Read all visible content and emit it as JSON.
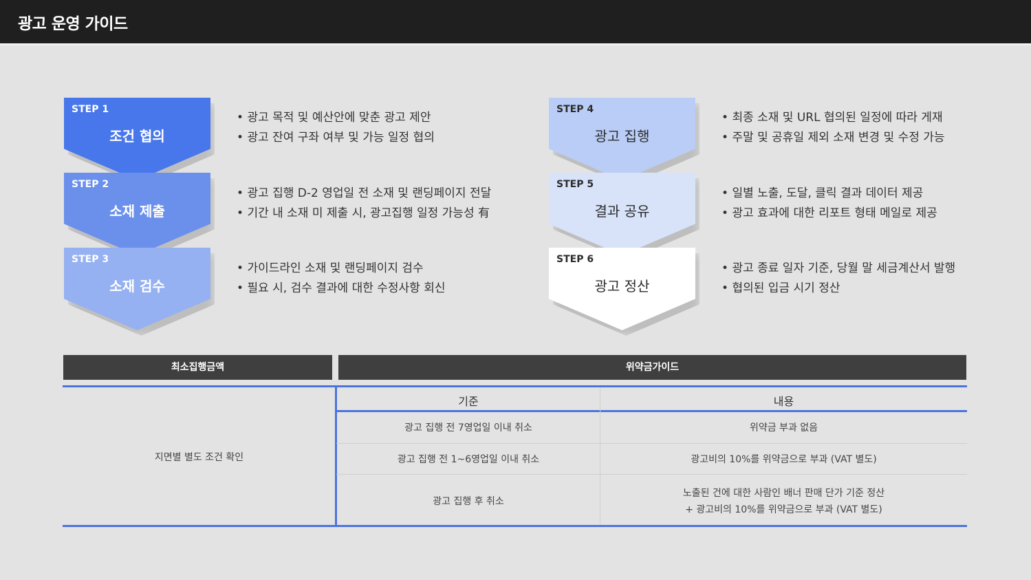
{
  "header": {
    "title": "광고 운영 가이드"
  },
  "steps": [
    {
      "num": "STEP 1",
      "name": "조건 협의",
      "color": "#4777eb",
      "lines": [
        "광고 목적 및 예산안에 맞춘 광고 제안",
        "광고 잔여 구좌 여부 및 가능 일정 협의"
      ]
    },
    {
      "num": "STEP 2",
      "name": "소재 제출",
      "color": "#6b90ec",
      "lines": [
        "광고 집행 D-2 영업일 전 소재 및 랜딩페이지 전달",
        "기간 내 소재 미 제출 시, 광고집행 일정 가능성 有"
      ]
    },
    {
      "num": "STEP 3",
      "name": "소재 검수",
      "color": "#95b1f1",
      "lines": [
        "가이드라인 소재 및 랜딩페이지 검수",
        "필요 시, 검수 결과에 대한 수정사항 회신"
      ]
    },
    {
      "num": "STEP 4",
      "name": "광고 집행",
      "color": "#bacdf6",
      "lines": [
        "최종 소재 및 URL 협의된 일정에 따라 게재",
        "주말 및 공휴일 제외 소재 변경 및 수정 가능"
      ]
    },
    {
      "num": "STEP 5",
      "name": "결과 공유",
      "color": "#d8e3fa",
      "lines": [
        "일별 노출, 도달, 클릭 결과 데이터 제공",
        "광고 효과에 대한 리포트 형태 메일로 제공"
      ]
    },
    {
      "num": "STEP 6",
      "name": "광고 정산",
      "color": "#ffffff",
      "lines": [
        "광고 종료 일자 기준, 당월 말 세금계산서 발행",
        "협의된 입금 시기 정산"
      ]
    }
  ],
  "table": {
    "min_header": "최소집행금액",
    "penalty_header": "위약금가이드",
    "min_value": "지면별 별도 조건 확인",
    "col_criteria": "기준",
    "col_content": "내용",
    "rows": [
      {
        "criteria": "광고 집행 전 7영업일 이내 취소",
        "content": "위약금 부과 없음",
        "content2": ""
      },
      {
        "criteria": "광고 집행 전 1~6영업일 이내 취소",
        "content": "광고비의 10%를 위약금으로 부과 (VAT 별도)",
        "content2": ""
      },
      {
        "criteria": "광고 집행 후 취소",
        "content": "노출된 건에 대한 사람인 배너 판매 단가 기준 정산",
        "content2": "+ 광고비의 10%를 위약금으로 부과 (VAT 별도)"
      }
    ]
  }
}
